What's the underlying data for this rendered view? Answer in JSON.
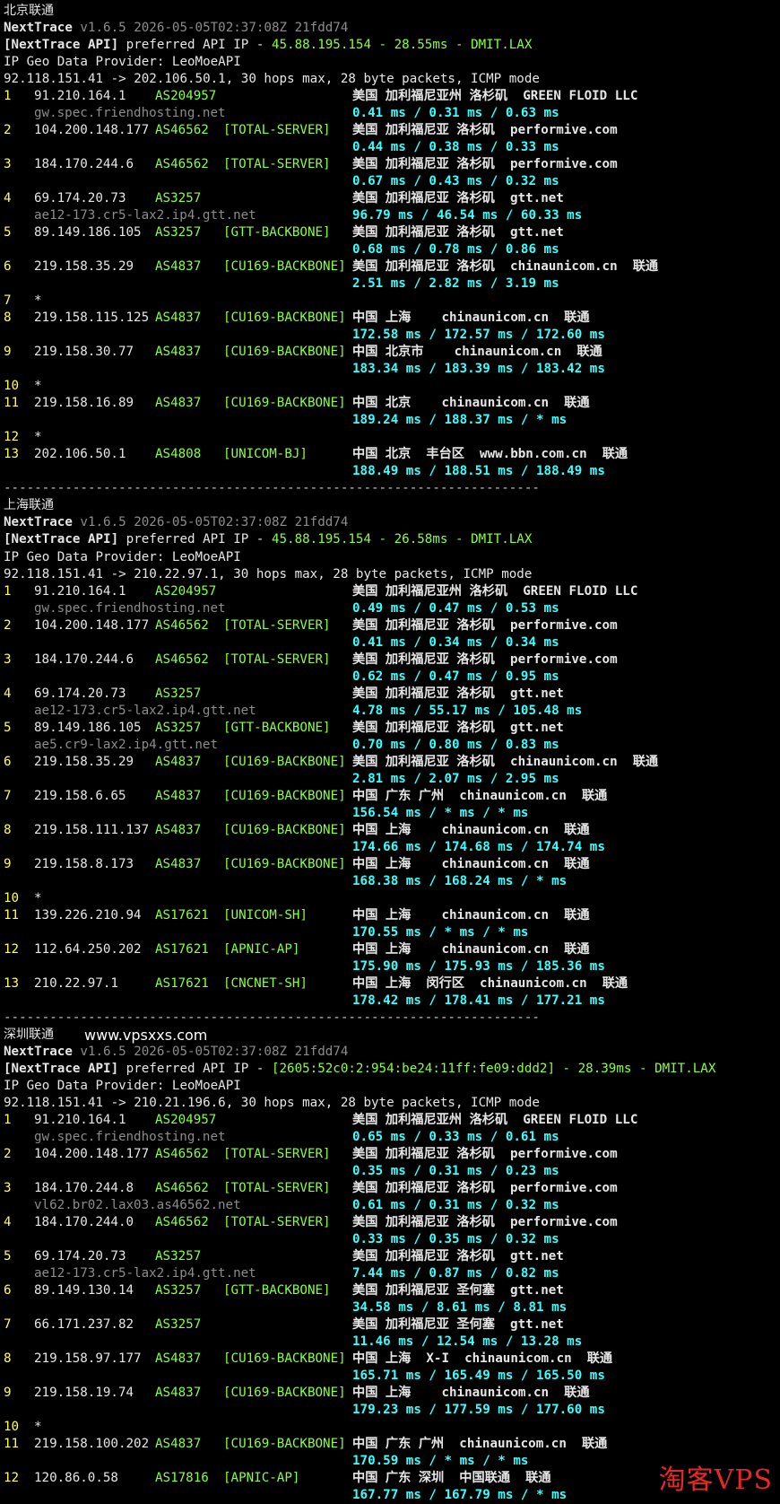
{
  "window": {
    "background": "#000000"
  },
  "colors": {
    "hop_num": "#ffff55",
    "ip": "#e6e6e6",
    "as": "#8aff3c",
    "latency": "#39ffff",
    "hostname": "#8c8c8c"
  },
  "blocks": [
    {
      "header": "北京联通",
      "site_label": "",
      "version_line": {
        "name": "NextTrace",
        "info": "v1.6.5 2026-05-05T02:37:08Z 21fdd74"
      },
      "api_line": {
        "prefix": "[NextTrace API]",
        "text": " preferred API IP - ",
        "ip": "45.88.195.154",
        "ms": "28.55ms",
        "node": "DMIT.LAX"
      },
      "geo_line": "IP Geo Data Provider: LeoMoeAPI",
      "trace_line": "92.118.151.41 -> 202.106.50.1, 30 hops max, 28 byte packets, ICMP mode",
      "hops": [
        {
          "n": "1",
          "ip": "91.210.164.1",
          "as": "AS204957",
          "tag": "",
          "geo": "美国 加利福尼亚州 洛杉矶",
          "org": "GREEN FLOID LLC",
          "host": "gw.spec.friendhosting.net",
          "rtt": "0.41 ms / 0.31 ms / 0.63 ms"
        },
        {
          "n": "2",
          "ip": "104.200.148.177",
          "as": "AS46562",
          "tag": "[TOTAL-SERVER]",
          "geo": "美国 加利福尼亚 洛杉矶",
          "org": "performive.com",
          "host": "",
          "rtt": "0.44 ms / 0.38 ms / 0.33 ms"
        },
        {
          "n": "3",
          "ip": "184.170.244.6",
          "as": "AS46562",
          "tag": "[TOTAL-SERVER]",
          "geo": "美国 加利福尼亚 洛杉矶",
          "org": "performive.com",
          "host": "",
          "rtt": "0.67 ms / 0.43 ms / 0.32 ms"
        },
        {
          "n": "4",
          "ip": "69.174.20.73",
          "as": "AS3257",
          "tag": "",
          "geo": "美国 加利福尼亚 洛杉矶",
          "org": "gtt.net",
          "host": "ae12-173.cr5-lax2.ip4.gtt.net",
          "rtt": "96.79 ms / 46.54 ms / 60.33 ms"
        },
        {
          "n": "5",
          "ip": "89.149.186.105",
          "as": "AS3257",
          "tag": "[GTT-BACKBONE]",
          "geo": "美国 加利福尼亚 洛杉矶",
          "org": "gtt.net",
          "host": "",
          "rtt": "0.68 ms / 0.78 ms / 0.86 ms"
        },
        {
          "n": "6",
          "ip": "219.158.35.29",
          "as": "AS4837",
          "tag": "[CU169-BACKBONE]",
          "geo": "美国 加利福尼亚 洛杉矶",
          "org": "chinaunicom.cn  联通",
          "host": "",
          "rtt": "2.51 ms / 2.82 ms / 3.19 ms"
        },
        {
          "n": "7",
          "star": true
        },
        {
          "n": "8",
          "ip": "219.158.115.125",
          "as": "AS4837",
          "tag": "[CU169-BACKBONE]",
          "geo": "中国 上海",
          "org": "  chinaunicom.cn  联通",
          "host": "",
          "rtt": "172.58 ms / 172.57 ms / 172.60 ms"
        },
        {
          "n": "9",
          "ip": "219.158.30.77",
          "as": "AS4837",
          "tag": "[CU169-BACKBONE]",
          "geo": "中国 北京市",
          "org": "  chinaunicom.cn  联通",
          "host": "",
          "rtt": "183.34 ms / 183.39 ms / 183.42 ms"
        },
        {
          "n": "10",
          "star": true
        },
        {
          "n": "11",
          "ip": "219.158.16.89",
          "as": "AS4837",
          "tag": "[CU169-BACKBONE]",
          "geo": "中国 北京",
          "org": "  chinaunicom.cn  联通",
          "host": "",
          "rtt": "189.24 ms / 188.37 ms / * ms"
        },
        {
          "n": "12",
          "star": true
        },
        {
          "n": "13",
          "ip": "202.106.50.1",
          "as": "AS4808",
          "tag": "[UNICOM-BJ]",
          "geo": "中国 北京  丰台区",
          "org": "www.bbn.com.cn  联通",
          "host": "",
          "rtt": "188.49 ms / 188.51 ms / 188.49 ms"
        }
      ],
      "separator": "----------------------------------------------------------------------"
    },
    {
      "header": "上海联通",
      "site_label": "",
      "version_line": {
        "name": "NextTrace",
        "info": "v1.6.5 2026-05-05T02:37:08Z 21fdd74"
      },
      "api_line": {
        "prefix": "[NextTrace API]",
        "text": " preferred API IP - ",
        "ip": "45.88.195.154",
        "ms": "26.58ms",
        "node": "DMIT.LAX"
      },
      "geo_line": "IP Geo Data Provider: LeoMoeAPI",
      "trace_line": "92.118.151.41 -> 210.22.97.1, 30 hops max, 28 byte packets, ICMP mode",
      "hops": [
        {
          "n": "1",
          "ip": "91.210.164.1",
          "as": "AS204957",
          "tag": "",
          "geo": "美国 加利福尼亚州 洛杉矶",
          "org": "GREEN FLOID LLC",
          "host": "gw.spec.friendhosting.net",
          "rtt": "0.49 ms / 0.47 ms / 0.53 ms"
        },
        {
          "n": "2",
          "ip": "104.200.148.177",
          "as": "AS46562",
          "tag": "[TOTAL-SERVER]",
          "geo": "美国 加利福尼亚 洛杉矶",
          "org": "performive.com",
          "host": "",
          "rtt": "0.41 ms / 0.34 ms / 0.34 ms"
        },
        {
          "n": "3",
          "ip": "184.170.244.6",
          "as": "AS46562",
          "tag": "[TOTAL-SERVER]",
          "geo": "美国 加利福尼亚 洛杉矶",
          "org": "performive.com",
          "host": "",
          "rtt": "0.62 ms / 0.47 ms / 0.95 ms"
        },
        {
          "n": "4",
          "ip": "69.174.20.73",
          "as": "AS3257",
          "tag": "",
          "geo": "美国 加利福尼亚 洛杉矶",
          "org": "gtt.net",
          "host": "ae12-173.cr5-lax2.ip4.gtt.net",
          "rtt": "4.78 ms / 55.17 ms / 105.48 ms"
        },
        {
          "n": "5",
          "ip": "89.149.186.105",
          "as": "AS3257",
          "tag": "[GTT-BACKBONE]",
          "geo": "美国 加利福尼亚 洛杉矶",
          "org": "gtt.net",
          "host": "ae5.cr9-lax2.ip4.gtt.net",
          "rtt": "0.70 ms / 0.80 ms / 0.83 ms"
        },
        {
          "n": "6",
          "ip": "219.158.35.29",
          "as": "AS4837",
          "tag": "[CU169-BACKBONE]",
          "geo": "美国 加利福尼亚 洛杉矶",
          "org": "chinaunicom.cn  联通",
          "host": "",
          "rtt": "2.81 ms / 2.07 ms / 2.95 ms"
        },
        {
          "n": "7",
          "ip": "219.158.6.65",
          "as": "AS4837",
          "tag": "[CU169-BACKBONE]",
          "geo": "中国 广东 广州",
          "org": "chinaunicom.cn  联通",
          "host": "",
          "rtt": "156.54 ms / * ms / * ms"
        },
        {
          "n": "8",
          "ip": "219.158.111.137",
          "as": "AS4837",
          "tag": "[CU169-BACKBONE]",
          "geo": "中国 上海",
          "org": "  chinaunicom.cn  联通",
          "host": "",
          "rtt": "174.66 ms / 174.68 ms / 174.74 ms"
        },
        {
          "n": "9",
          "ip": "219.158.8.173",
          "as": "AS4837",
          "tag": "[CU169-BACKBONE]",
          "geo": "中国 上海",
          "org": "  chinaunicom.cn  联通",
          "host": "",
          "rtt": "168.38 ms / 168.24 ms / * ms"
        },
        {
          "n": "10",
          "star": true
        },
        {
          "n": "11",
          "ip": "139.226.210.94",
          "as": "AS17621",
          "tag": "[UNICOM-SH]",
          "geo": "中国 上海",
          "org": "  chinaunicom.cn  联通",
          "host": "",
          "rtt": "170.55 ms / * ms / * ms"
        },
        {
          "n": "12",
          "ip": "112.64.250.202",
          "as": "AS17621",
          "tag": "[APNIC-AP]",
          "geo": "中国 上海",
          "org": "  chinaunicom.cn  联通",
          "host": "",
          "rtt": "175.90 ms / 175.93 ms / 185.36 ms"
        },
        {
          "n": "13",
          "ip": "210.22.97.1",
          "as": "AS17621",
          "tag": "[CNCNET-SH]",
          "geo": "中国 上海  闵行区",
          "org": "chinaunicom.cn  联通",
          "host": "",
          "rtt": "178.42 ms / 178.41 ms / 177.21 ms"
        }
      ],
      "separator": "----------------------------------------------------------------------"
    },
    {
      "header": "深圳联通",
      "site_label": "www.vpsxxs.com",
      "version_line": {
        "name": "NextTrace",
        "info": "v1.6.5 2026-05-05T02:37:08Z 21fdd74"
      },
      "api_line": {
        "prefix": "[NextTrace API]",
        "text": " preferred API IP - ",
        "ip": "[2605:52c0:2:954:be24:11ff:fe09:ddd2]",
        "ms": "28.39ms",
        "node": "DMIT.LAX"
      },
      "geo_line": "IP Geo Data Provider: LeoMoeAPI",
      "trace_line": "92.118.151.41 -> 210.21.196.6, 30 hops max, 28 byte packets, ICMP mode",
      "hops": [
        {
          "n": "1",
          "ip": "91.210.164.1",
          "as": "AS204957",
          "tag": "",
          "geo": "美国 加利福尼亚州 洛杉矶",
          "org": "GREEN FLOID LLC",
          "host": "gw.spec.friendhosting.net",
          "rtt": "0.65 ms / 0.33 ms / 0.61 ms"
        },
        {
          "n": "2",
          "ip": "104.200.148.177",
          "as": "AS46562",
          "tag": "[TOTAL-SERVER]",
          "geo": "美国 加利福尼亚 洛杉矶",
          "org": "performive.com",
          "host": "",
          "rtt": "0.35 ms / 0.31 ms / 0.23 ms"
        },
        {
          "n": "3",
          "ip": "184.170.244.8",
          "as": "AS46562",
          "tag": "[TOTAL-SERVER]",
          "geo": "美国 加利福尼亚 洛杉矶",
          "org": "performive.com",
          "host": "vl62.br02.lax03.as46562.net",
          "rtt": "0.61 ms / 0.31 ms / 0.32 ms"
        },
        {
          "n": "4",
          "ip": "184.170.244.0",
          "as": "AS46562",
          "tag": "[TOTAL-SERVER]",
          "geo": "美国 加利福尼亚 洛杉矶",
          "org": "performive.com",
          "host": "",
          "rtt": "0.33 ms / 0.35 ms / 0.32 ms"
        },
        {
          "n": "5",
          "ip": "69.174.20.73",
          "as": "AS3257",
          "tag": "",
          "geo": "美国 加利福尼亚 洛杉矶",
          "org": "gtt.net",
          "host": "ae12-173.cr5-lax2.ip4.gtt.net",
          "rtt": "7.44 ms / 0.87 ms / 0.82 ms"
        },
        {
          "n": "6",
          "ip": "89.149.130.14",
          "as": "AS3257",
          "tag": "[GTT-BACKBONE]",
          "geo": "美国 加利福尼亚 圣何塞",
          "org": "gtt.net",
          "host": "",
          "rtt": "34.58 ms / 8.61 ms / 8.81 ms"
        },
        {
          "n": "7",
          "ip": "66.171.237.82",
          "as": "AS3257",
          "tag": "",
          "geo": "美国 加利福尼亚 圣何塞",
          "org": "gtt.net",
          "host": "",
          "rtt": "11.46 ms / 12.54 ms / 13.28 ms"
        },
        {
          "n": "8",
          "ip": "219.158.97.177",
          "as": "AS4837",
          "tag": "[CU169-BACKBONE]",
          "geo": "中国 上海  X-I",
          "org": "chinaunicom.cn  联通",
          "host": "",
          "rtt": "165.71 ms / 165.49 ms / 165.50 ms"
        },
        {
          "n": "9",
          "ip": "219.158.19.74",
          "as": "AS4837",
          "tag": "[CU169-BACKBONE]",
          "geo": "中国 上海",
          "org": "  chinaunicom.cn  联通",
          "host": "",
          "rtt": "179.23 ms / 177.59 ms / 177.60 ms"
        },
        {
          "n": "10",
          "star": true
        },
        {
          "n": "11",
          "ip": "219.158.100.202",
          "as": "AS4837",
          "tag": "[CU169-BACKBONE]",
          "geo": "中国 广东 广州",
          "org": "chinaunicom.cn  联通",
          "host": "",
          "rtt": "170.59 ms / * ms / * ms"
        },
        {
          "n": "12",
          "ip": "120.86.0.58",
          "as": "AS17816",
          "tag": "[APNIC-AP]",
          "geo": "中国 广东 深圳",
          "org": "中国联通  联通",
          "host": "",
          "rtt": "167.77 ms / 167.79 ms / * ms"
        }
      ],
      "separator": ""
    }
  ],
  "watermark": "淘客VPS"
}
